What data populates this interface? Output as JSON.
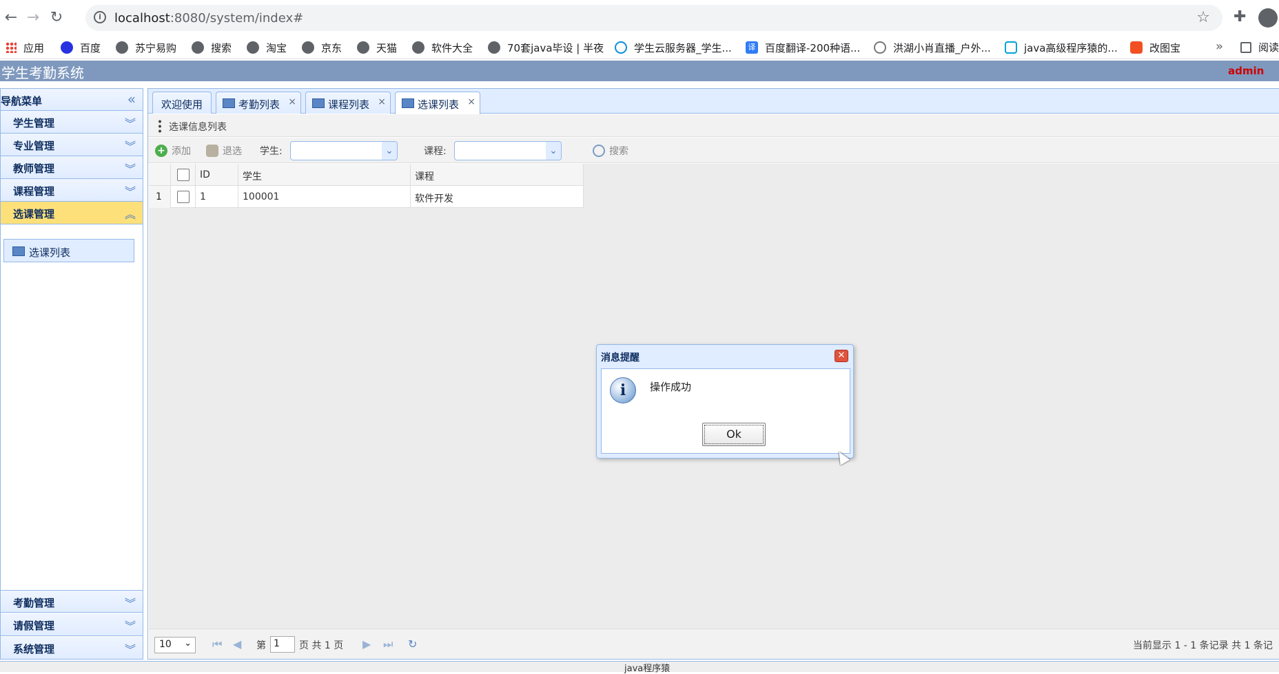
{
  "browser": {
    "url_host": "localhost",
    "url_rest": ":8080/system/index#",
    "bookmarks": [
      "应用",
      "百度",
      "苏宁易购",
      "搜索",
      "淘宝",
      "京东",
      "天猫",
      "软件大全",
      "70套java毕设 | 半夜",
      "学生云服务器_学生...",
      "百度翻译-200种语...",
      "洪湖小肖直播_户外...",
      "java高级程序猿的...",
      "改图宝"
    ],
    "more": "»",
    "reading_list": "阅读"
  },
  "app": {
    "title": "学生考勤系统",
    "user": "admin"
  },
  "sidebar": {
    "header": "导航菜单",
    "collapse_icon": "«",
    "sections": [
      {
        "label": "学生管理"
      },
      {
        "label": "专业管理"
      },
      {
        "label": "教师管理"
      },
      {
        "label": "课程管理"
      },
      {
        "label": "选课管理"
      }
    ],
    "active_item": "选课列表",
    "bottom_sections": [
      {
        "label": "考勤管理"
      },
      {
        "label": "请假管理"
      },
      {
        "label": "系统管理"
      }
    ]
  },
  "tabs": [
    {
      "label": "欢迎使用"
    },
    {
      "label": "考勤列表"
    },
    {
      "label": "课程列表"
    },
    {
      "label": "选课列表"
    }
  ],
  "panel": {
    "title": "选课信息列表"
  },
  "toolbar": {
    "add": "添加",
    "withdraw": "退选",
    "student_label": "学生:",
    "course_label": "课程:",
    "search": "搜索"
  },
  "table": {
    "columns": [
      "ID",
      "学生",
      "课程"
    ],
    "rows": [
      {
        "num": "1",
        "id": "1",
        "student": "100001",
        "course": "软件开发"
      }
    ]
  },
  "pager": {
    "page_size": "10",
    "page_prefix": "第",
    "page_value": "1",
    "page_suffix": "页 共 1 页",
    "info": "当前显示 1 - 1 条记录 共 1 条记"
  },
  "footer": {
    "text": "java程序猿"
  },
  "modal": {
    "title": "消息提醒",
    "message": "操作成功",
    "ok": "Ok",
    "icon_glyph": "i",
    "close_glyph": "✕"
  }
}
